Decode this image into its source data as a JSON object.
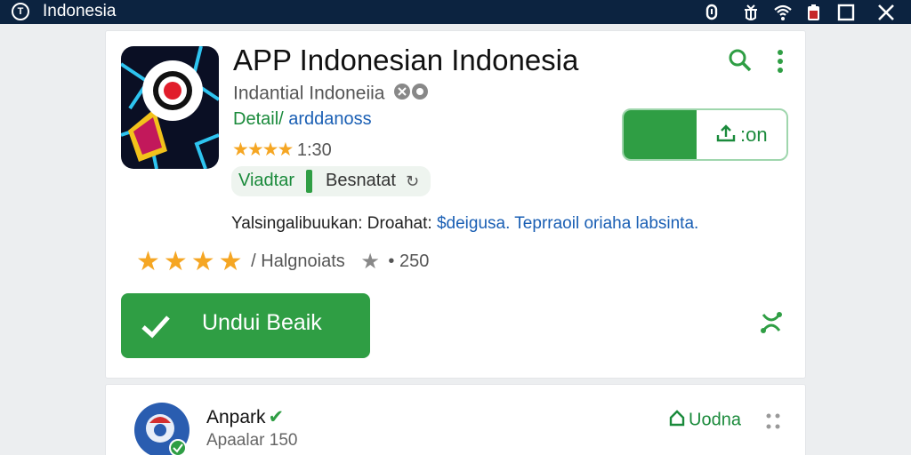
{
  "window": {
    "title": "Indonesia",
    "app_icon_glyph": "T",
    "system_icons": [
      "notification-icon",
      "bug-icon",
      "wifi-icon",
      "battery-icon",
      "maximize-icon",
      "close-icon"
    ]
  },
  "app": {
    "name": "APP Indonesian Indonesia",
    "developer": "Indantial Indoneiia",
    "detail_link_prefix": "Detail/ ",
    "detail_link_text": "arddanoss",
    "mini_rating_stars": "★★★★",
    "mini_rating_value": "1:30",
    "chip_1": "Viadtar",
    "chip_2": "Besnatat",
    "chip_2_icon": "refresh-icon",
    "toggle_label": ":on",
    "description_prefix": "Yalsingalibuukan: Droahat: ",
    "description_link": "$deigusa. Teprraoil oriaha labsinta.",
    "rating_stars": "★★★★",
    "rating_count_label": "/ Halgnoiats",
    "rating_grey_star": "★",
    "rating_number": "• 250",
    "install_label": "Undui Beaik"
  },
  "list_item": {
    "name": "Anpark",
    "name_badge": "✔",
    "subtitle": "Apaalar 150",
    "action_label": "Uodna"
  },
  "colors": {
    "titlebar": "#0c2340",
    "accent_green": "#2f9e44",
    "link_blue": "#1a5fb4",
    "star_orange": "#f5a623"
  }
}
